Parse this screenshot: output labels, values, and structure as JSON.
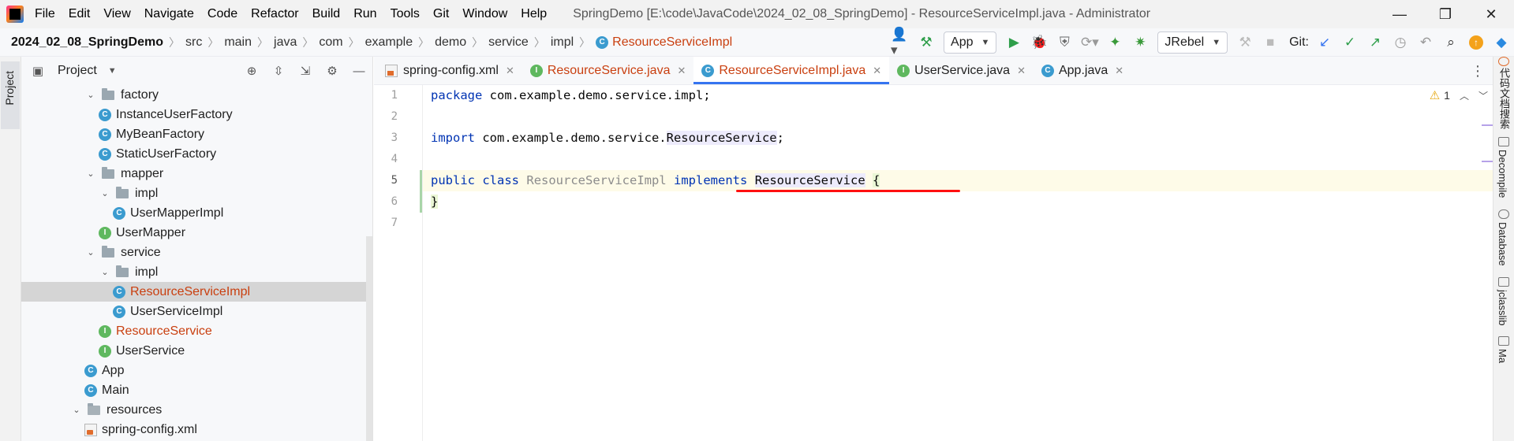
{
  "titlebar": {
    "menus": [
      "File",
      "Edit",
      "View",
      "Navigate",
      "Code",
      "Refactor",
      "Build",
      "Run",
      "Tools",
      "Git",
      "Window",
      "Help"
    ],
    "window_title": "SpringDemo [E:\\code\\JavaCode\\2024_02_08_SpringDemo] - ResourceServiceImpl.java - Administrator",
    "controls": {
      "minimize": "—",
      "restore": "❐",
      "close": "✕"
    }
  },
  "breadcrumb": [
    "2024_02_08_SpringDemo",
    "src",
    "main",
    "java",
    "com",
    "example",
    "demo",
    "service",
    "impl",
    "ResourceServiceImpl"
  ],
  "toolbar": {
    "run_config": "App",
    "jrebel_config": "JRebel",
    "git_label": "Git:"
  },
  "left_stripe": {
    "project": "Project"
  },
  "project_panel": {
    "title": "Project",
    "tree": [
      {
        "label": "factory",
        "kind": "folder",
        "depth": 1,
        "expanded": true
      },
      {
        "label": "InstanceUserFactory",
        "kind": "class",
        "depth": 2
      },
      {
        "label": "MyBeanFactory",
        "kind": "class",
        "depth": 2
      },
      {
        "label": "StaticUserFactory",
        "kind": "class",
        "depth": 2
      },
      {
        "label": "mapper",
        "kind": "folder",
        "depth": 1,
        "expanded": true
      },
      {
        "label": "impl",
        "kind": "folder",
        "depth": 2,
        "expanded": true
      },
      {
        "label": "UserMapperImpl",
        "kind": "class",
        "depth": 3
      },
      {
        "label": "UserMapper",
        "kind": "interface",
        "depth": 2
      },
      {
        "label": "service",
        "kind": "folder",
        "depth": 1,
        "expanded": true
      },
      {
        "label": "impl",
        "kind": "folder",
        "depth": 2,
        "expanded": true
      },
      {
        "label": "ResourceServiceImpl",
        "kind": "class",
        "depth": 3,
        "selected": true,
        "modified": true
      },
      {
        "label": "UserServiceImpl",
        "kind": "class",
        "depth": 3
      },
      {
        "label": "ResourceService",
        "kind": "interface",
        "depth": 2,
        "modified": true
      },
      {
        "label": "UserService",
        "kind": "interface",
        "depth": 2
      },
      {
        "label": "App",
        "kind": "main",
        "depth": 1
      },
      {
        "label": "Main",
        "kind": "main",
        "depth": 1
      },
      {
        "label": "resources",
        "kind": "resfolder",
        "depth": 0,
        "expanded": true
      },
      {
        "label": "spring-config.xml",
        "kind": "xml",
        "depth": 1
      }
    ]
  },
  "editor_tabs": [
    {
      "label": "spring-config.xml",
      "kind": "xml"
    },
    {
      "label": "ResourceService.java",
      "kind": "interface",
      "modified": true
    },
    {
      "label": "ResourceServiceImpl.java",
      "kind": "class",
      "modified": true,
      "active": true
    },
    {
      "label": "UserService.java",
      "kind": "interface"
    },
    {
      "label": "App.java",
      "kind": "main"
    }
  ],
  "editor": {
    "line_numbers": [
      "1",
      "2",
      "3",
      "4",
      "5",
      "6",
      "7"
    ],
    "current_line": 5,
    "code": {
      "l1_kw": "package",
      "l1_rest": " com.example.demo.service.impl;",
      "l3_kw": "import",
      "l3_pkg": " com.example.demo.service.",
      "l3_ref": "ResourceService",
      "l3_end": ";",
      "l5_kw1": "public",
      "l5_kw2": "class",
      "l5_name": "ResourceServiceImpl",
      "l5_kw3": "implements",
      "l5_iface": "ResourceService",
      "l5_brace": "{",
      "l6_brace": "}"
    },
    "inspection": {
      "warning_count": "1"
    }
  },
  "right_stripe": [
    "代码文档搜索",
    "Decompile",
    "Database",
    "jclasslib",
    "Ma"
  ],
  "colors": {
    "accent": "#3574f0",
    "modified": "#c93f0f",
    "keyword": "#0033b3",
    "error_underline": "#ff1010"
  }
}
